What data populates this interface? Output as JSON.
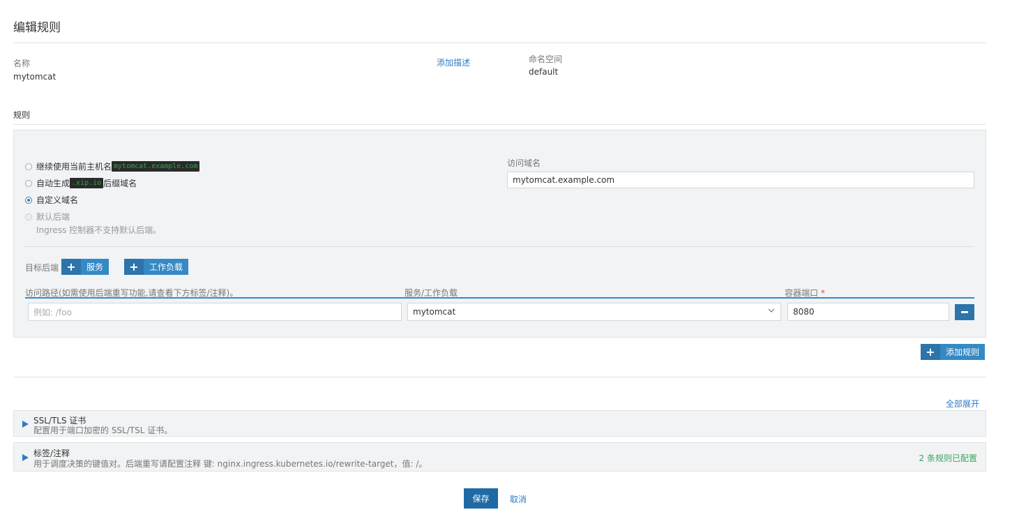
{
  "header": {
    "title": "编辑规则"
  },
  "meta": {
    "name_label": "名称",
    "name_value": "mytomcat",
    "add_desc_link": "添加描述",
    "namespace_label": "命名空间",
    "namespace_value": "default"
  },
  "rules": {
    "section_label": "规则",
    "host_options": [
      {
        "label": "继续使用当前主机名",
        "chip": "mytomcat.example.com",
        "suffix": "",
        "checked": false,
        "disabled": false
      },
      {
        "label": "自动生成",
        "chip": ".xip.io",
        "suffix": "后缀域名",
        "checked": false,
        "disabled": false
      },
      {
        "label": "自定义域名",
        "chip": "",
        "suffix": "",
        "checked": true,
        "disabled": false
      },
      {
        "label": "默认后端",
        "chip": "",
        "suffix": "",
        "checked": false,
        "disabled": true,
        "note": "Ingress 控制器不支持默认后端。"
      }
    ],
    "domain_label": "访问域名",
    "domain_value": "mytomcat.example.com",
    "target_backend_label": "目标后端",
    "add_service_label": "服务",
    "add_workload_label": "工作负载",
    "columns": {
      "path": "访问路径(如需使用后端重写功能,请查看下方标签/注释)。",
      "target": "服务/工作负载",
      "port": "容器端口",
      "required_mark": "*"
    },
    "row": {
      "path_placeholder": "例如: /foo",
      "target_value": "mytomcat",
      "port_value": "8080"
    },
    "add_rule_label": "添加规则"
  },
  "sections": {
    "expand_all": "全部展开",
    "ssl": {
      "title": "SSL/TLS 证书",
      "desc": "配置用于端口加密的 SSL/TSL 证书。"
    },
    "labels": {
      "title": "标签/注释",
      "desc": "用于调度决策的键值对。后端重写请配置注释 键: nginx.ingress.kubernetes.io/rewrite-target，值: /。",
      "status": "2 条规则已配置"
    }
  },
  "footer": {
    "save_label": "保存",
    "cancel_label": "取消"
  },
  "colors": {
    "accent": "#3589c5",
    "accent_dark": "#1f6aa5",
    "success": "#3aa55f",
    "chip_bg": "#2a2a2a",
    "chip_fg": "#2ea84a"
  }
}
